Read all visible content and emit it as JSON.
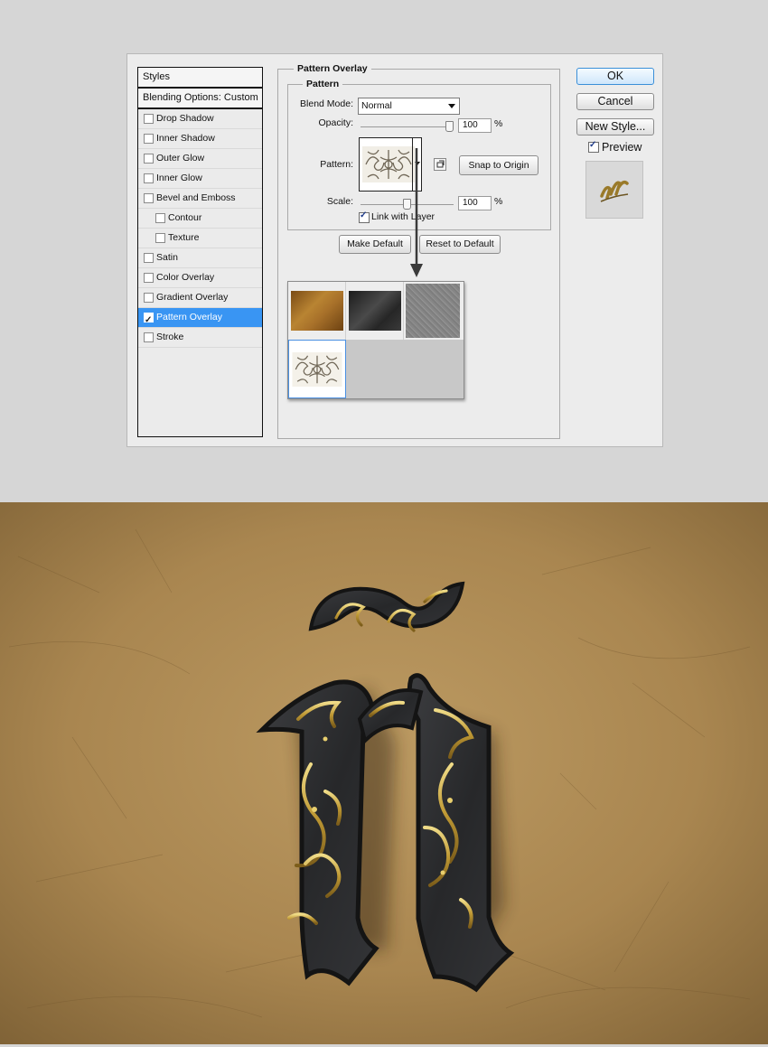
{
  "styles_panel": {
    "header": "Styles",
    "blending": "Blending Options: Custom",
    "items": [
      {
        "label": "Drop Shadow",
        "checked": false,
        "indent": false
      },
      {
        "label": "Inner Shadow",
        "checked": false,
        "indent": false
      },
      {
        "label": "Outer Glow",
        "checked": false,
        "indent": false
      },
      {
        "label": "Inner Glow",
        "checked": false,
        "indent": false
      },
      {
        "label": "Bevel and Emboss",
        "checked": false,
        "indent": false
      },
      {
        "label": "Contour",
        "checked": false,
        "indent": true
      },
      {
        "label": "Texture",
        "checked": false,
        "indent": true
      },
      {
        "label": "Satin",
        "checked": false,
        "indent": false
      },
      {
        "label": "Color Overlay",
        "checked": false,
        "indent": false
      },
      {
        "label": "Gradient Overlay",
        "checked": false,
        "indent": false
      },
      {
        "label": "Pattern Overlay",
        "checked": true,
        "indent": false,
        "selected": true
      },
      {
        "label": "Stroke",
        "checked": false,
        "indent": false
      }
    ]
  },
  "pattern_overlay": {
    "title": "Pattern Overlay",
    "group_title": "Pattern",
    "blend_mode_label": "Blend Mode:",
    "blend_mode_value": "Normal",
    "opacity_label": "Opacity:",
    "opacity_value": "100",
    "opacity_unit": "%",
    "opacity_level": 1.0,
    "pattern_label": "Pattern:",
    "snap_button": "Snap to Origin",
    "scale_label": "Scale:",
    "scale_value": "100",
    "scale_unit": "%",
    "scale_level": 0.5,
    "link_label": "Link with Layer",
    "link_checked": true,
    "make_default_button": "Make Default",
    "reset_default_button": "Reset to Default"
  },
  "picker": {
    "swatches": [
      {
        "name": "brown-paper-pattern",
        "color": "#9c6a2a"
      },
      {
        "name": "dark-stone-pattern",
        "color": "#2e2e2e"
      },
      {
        "name": "gray-noise-pattern",
        "color": "#8a8a8a"
      },
      {
        "name": "ornate-scroll-pattern",
        "color": "#f4f1e9"
      }
    ],
    "selected_index": 3
  },
  "side_buttons": {
    "ok": "OK",
    "cancel": "Cancel",
    "new_style": "New Style...",
    "preview_label": "Preview",
    "preview_checked": true
  },
  "colors": {
    "dialog_bg": "#ececec",
    "selection_blue": "#3995f3",
    "paper": "#b08a52",
    "gold": "#c9a53c",
    "letter_dark": "#2b2c2e"
  }
}
